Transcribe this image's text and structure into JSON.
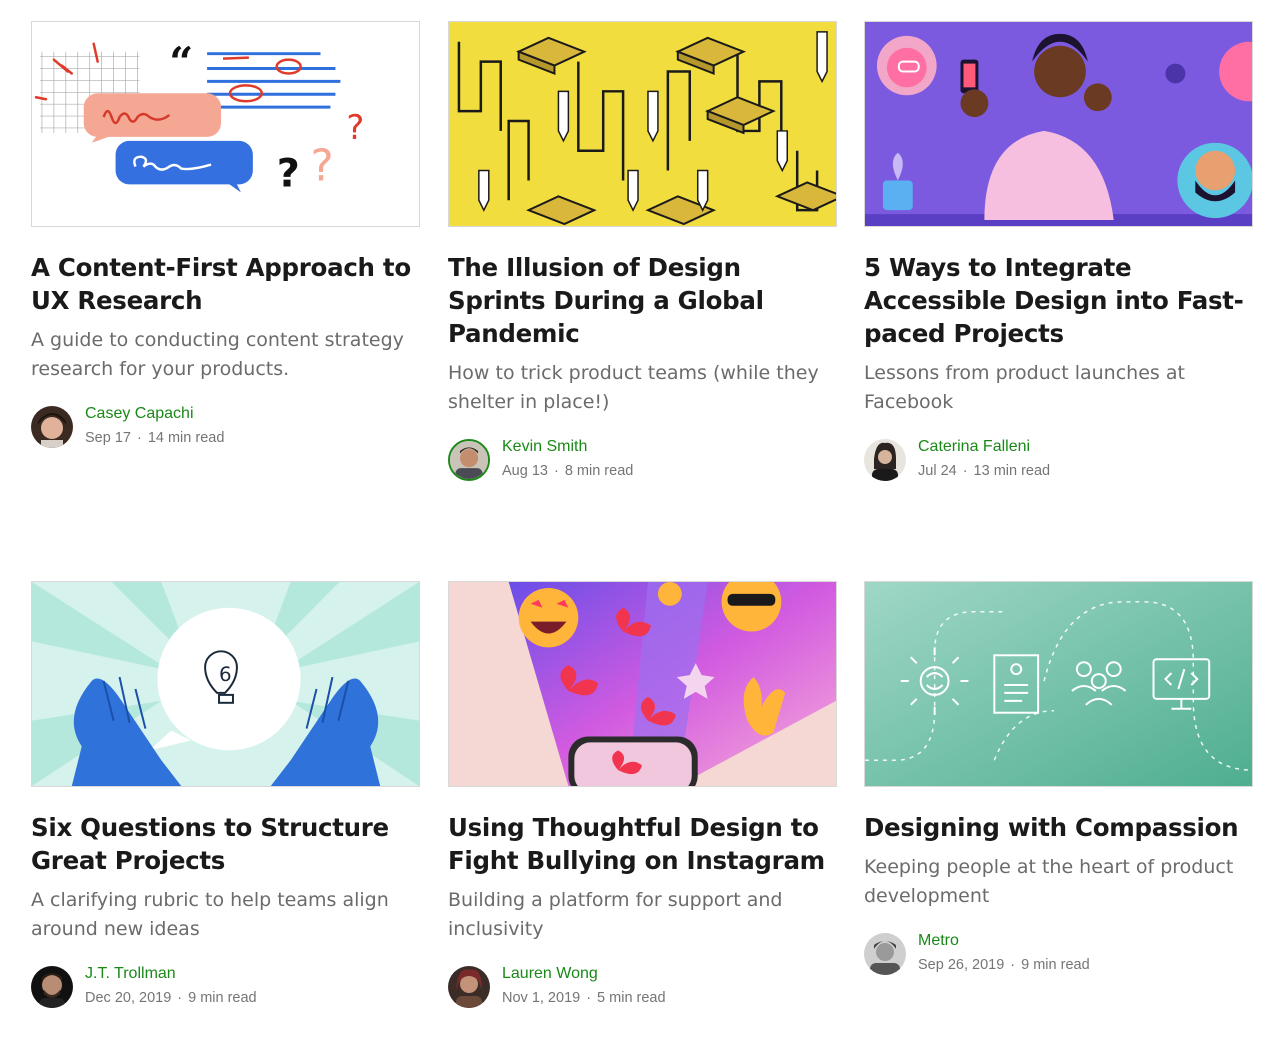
{
  "articles": [
    {
      "title": "A Content-First Approach to UX Research",
      "subtitle": "A guide to conducting content strategy research for your products.",
      "author": "Casey Capachi",
      "date": "Sep 17",
      "read_time": "14 min read"
    },
    {
      "title": "The Illusion of Design Sprints During a Global Pandemic",
      "subtitle": "How to trick product teams (while they shelter in place!)",
      "author": "Kevin Smith",
      "date": "Aug 13",
      "read_time": "8 min read"
    },
    {
      "title": "5 Ways to Integrate Accessible Design into Fast-paced Projects",
      "subtitle": "Lessons from product launches at Facebook",
      "author": "Caterina Falleni",
      "date": "Jul 24",
      "read_time": "13 min read"
    },
    {
      "title": "Six Questions to Structure Great Projects",
      "subtitle": "A clarifying rubric to help teams align around new ideas",
      "author": "J.T. Trollman",
      "date": "Dec 20, 2019",
      "read_time": "9 min read"
    },
    {
      "title": "Using Thoughtful Design to Fight Bullying on Instagram",
      "subtitle": "Building a platform for support and inclusivity",
      "author": "Lauren Wong",
      "date": "Nov 1, 2019",
      "read_time": "5 min read"
    },
    {
      "title": "Designing with Compassion",
      "subtitle": "Keeping people at the heart of product development",
      "author": "Metro",
      "date": "Sep 26, 2019",
      "read_time": "9 min read"
    }
  ],
  "separator": "·",
  "colors": {
    "author_link": "#1a8917",
    "meta_text": "#757575",
    "subtitle_text": "#6b6b6b",
    "title_text": "#1a1a1a"
  }
}
